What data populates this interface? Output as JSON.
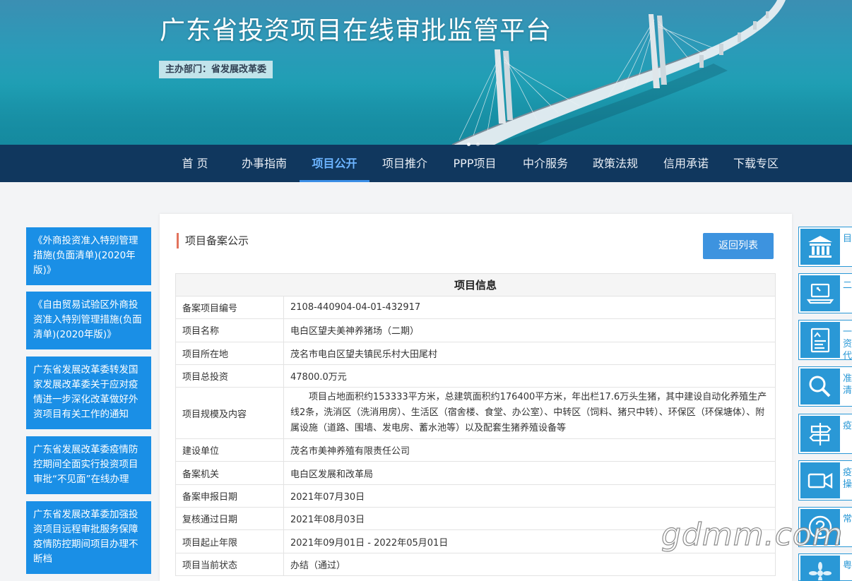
{
  "header": {
    "title": "广东省投资项目在线审批监管平台",
    "sponsor": "主办部门：省发展改革委"
  },
  "nav": [
    {
      "label": "首 页"
    },
    {
      "label": "办事指南"
    },
    {
      "label": "项目公开",
      "active": true
    },
    {
      "label": "项目推介"
    },
    {
      "label": "PPP项目"
    },
    {
      "label": "中介服务"
    },
    {
      "label": "政策法规"
    },
    {
      "label": "信用承诺"
    },
    {
      "label": "下载专区"
    }
  ],
  "sidebar": {
    "links": [
      "《外商投资准入特别管理措施(负面清单)(2020年版)》",
      "《自由贸易试验区外商投资准入特别管理措施(负面清单)(2020年版)》",
      "广东省发展改革委转发国家发展改革委关于应对疫情进一步深化改革做好外资项目有关工作的通知",
      "广东省发展改革委疫情防控期间全面实行投资项目审批“不见面”在线办理",
      "广东省发展改革委加强投资项目远程审批服务保障疫情防控期间项目办理不断档"
    ]
  },
  "panel": {
    "heading": "项目备案公示",
    "back_button": "返回列表",
    "table_title": "项目信息",
    "rows": [
      {
        "key": "备案项目编号",
        "value": "2108-440904-04-01-432917"
      },
      {
        "key": "项目名称",
        "value": "电白区望夫美神养猪场（二期）"
      },
      {
        "key": "项目所在地",
        "value": "茂名市电白区望夫镇民乐村大田尾村"
      },
      {
        "key": "项目总投资",
        "value": "47800.0万元"
      },
      {
        "key": "项目规模及内容",
        "value": "项目占地面积约153333平方米，总建筑面积约176400平方米，年出栏17.6万头生猪，其中建设自动化养殖生产线2条，洗消区（洗消用房）、生活区（宿舍楼、食堂、办公室）、中转区（饲料、猪只中转）、环保区（环保塘体）、附属设施（道路、围墙、发电房、蓄水池等）以及配套生猪养殖设备等"
      },
      {
        "key": "建设单位",
        "value": "茂名市美神养殖有限责任公司"
      },
      {
        "key": "备案机关",
        "value": "电白区发展和改革局"
      },
      {
        "key": "备案申报日期",
        "value": "2021年07月30日"
      },
      {
        "key": "复核通过日期",
        "value": "2021年08月03日"
      },
      {
        "key": "项目起止年限",
        "value": "2021年09月01日 - 2022年05月01日"
      },
      {
        "key": "项目当前状态",
        "value": "办结（通过）"
      }
    ]
  },
  "quick_links": [
    {
      "icon": "bank-icon",
      "label": "目"
    },
    {
      "icon": "laptop-icon",
      "label": "二"
    },
    {
      "icon": "document-chart-icon",
      "label": "一资代"
    },
    {
      "icon": "magnifier-icon",
      "label": "准清"
    },
    {
      "icon": "signpost-icon",
      "label": "疫"
    },
    {
      "icon": "video-camera-icon",
      "label": "疫操"
    },
    {
      "icon": "help-icon",
      "label": "常"
    },
    {
      "icon": "flower-logo-icon",
      "label": "粤"
    }
  ],
  "watermark": "gdmm.com",
  "colors": {
    "nav_bg": "#10375e",
    "nav_active": "#6cb4ff",
    "sidebar_blue": "#1a8fe6",
    "button_blue": "#3d93df",
    "accent_bar": "#e2735d",
    "quick_blue": "#2a98d6"
  }
}
